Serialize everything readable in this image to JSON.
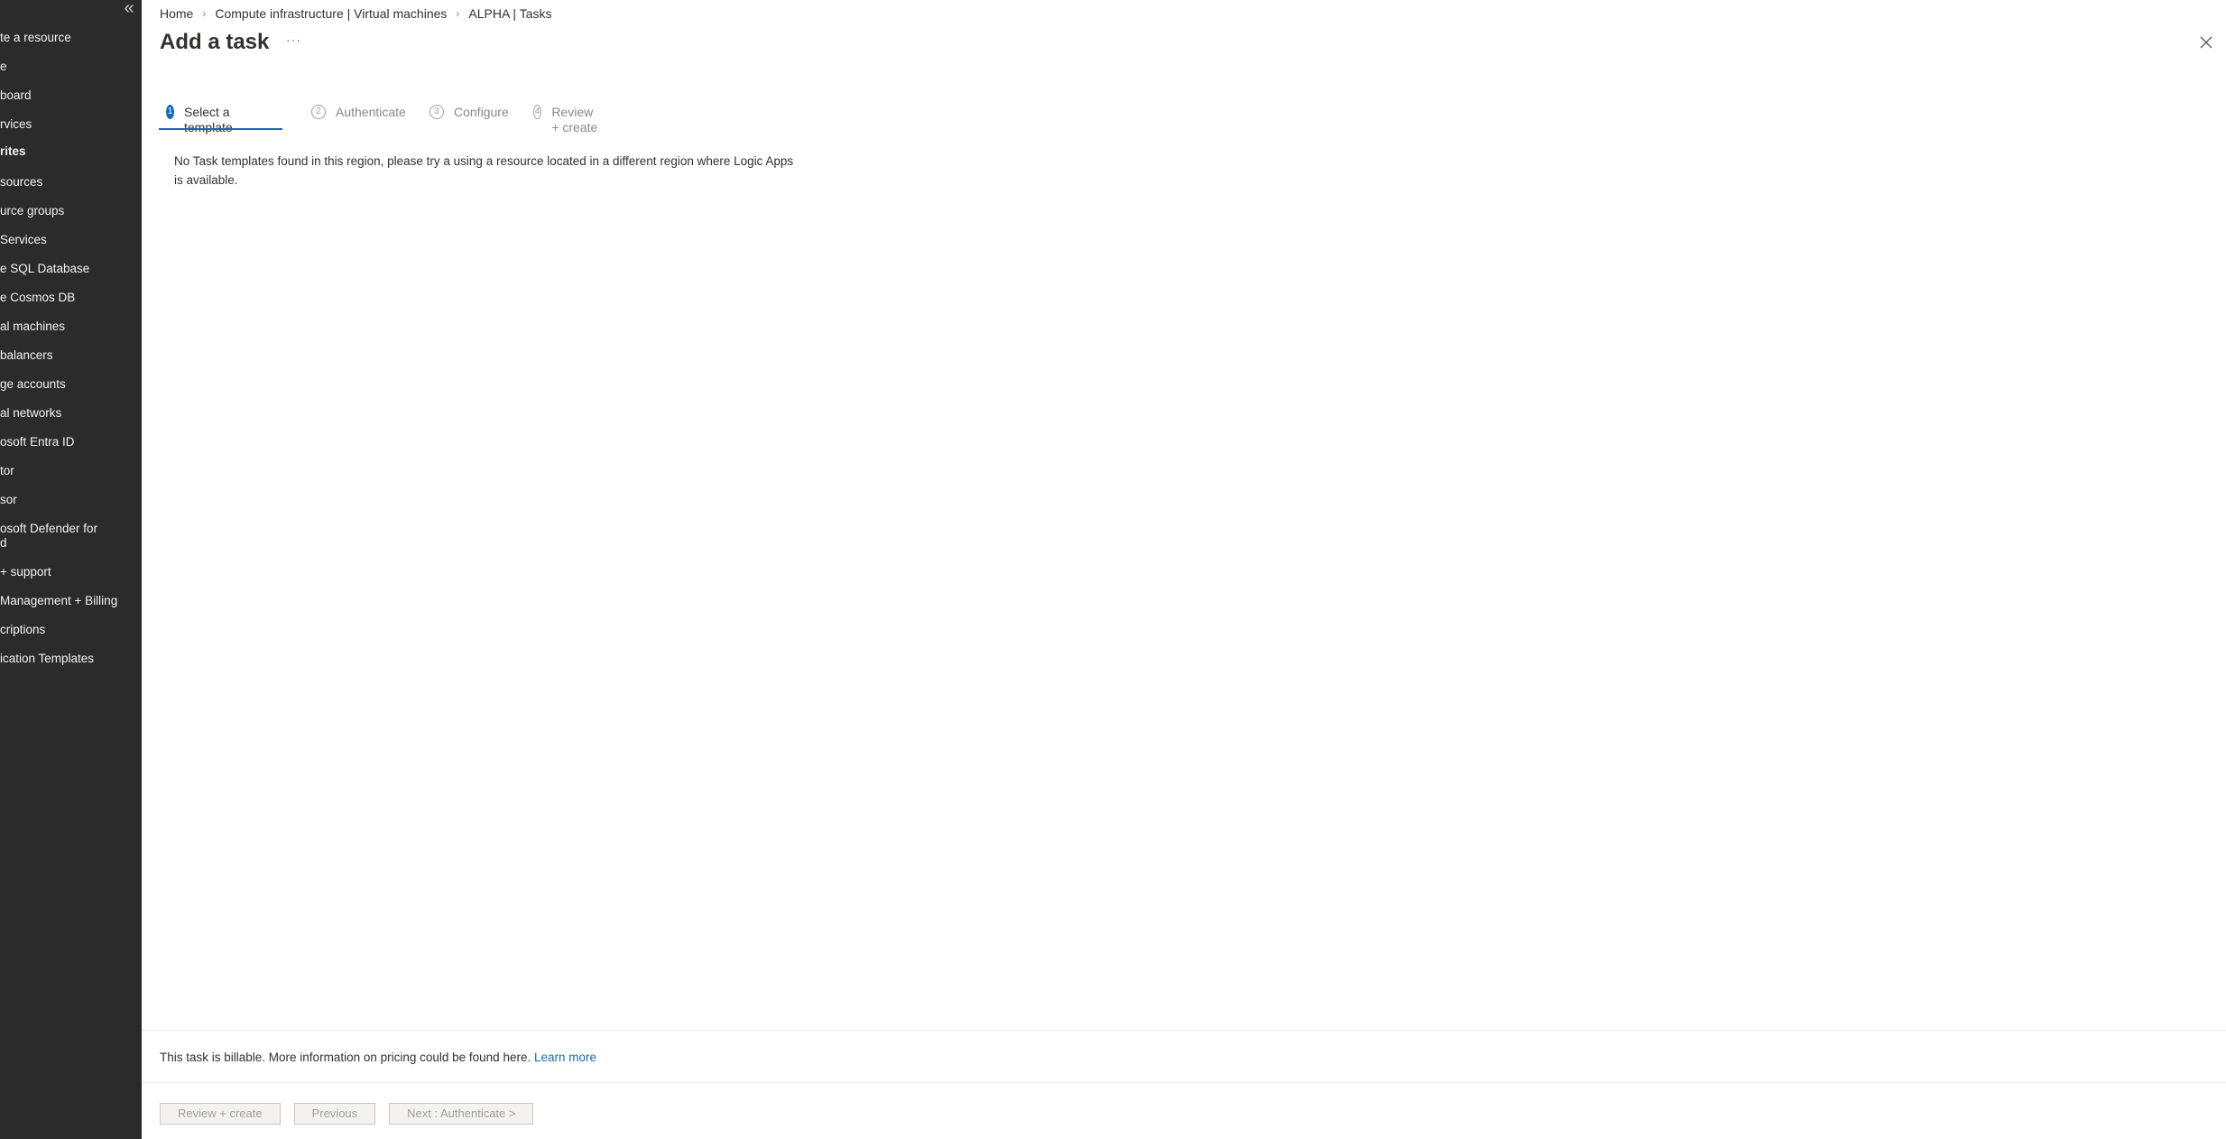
{
  "sidebar": {
    "collapse_label": "«",
    "items": [
      {
        "label": "te a resource",
        "section": false
      },
      {
        "label": "e",
        "section": false
      },
      {
        "label": "board",
        "section": false
      },
      {
        "label": "rvices",
        "section": false
      },
      {
        "label": "rites",
        "section": true
      },
      {
        "label": "sources",
        "section": false
      },
      {
        "label": "urce groups",
        "section": false
      },
      {
        "label": "Services",
        "section": false
      },
      {
        "label": "e SQL Database",
        "section": false
      },
      {
        "label": "e Cosmos DB",
        "section": false
      },
      {
        "label": "al machines",
        "section": false
      },
      {
        "label": " balancers",
        "section": false
      },
      {
        "label": "ge accounts",
        "section": false
      },
      {
        "label": "al networks",
        "section": false
      },
      {
        "label": "osoft Entra ID",
        "section": false
      },
      {
        "label": "tor",
        "section": false
      },
      {
        "label": "sor",
        "section": false
      },
      {
        "label": "osoft Defender for",
        "section": false
      },
      {
        "label": "d",
        "section": false
      },
      {
        "label": " + support",
        "section": false
      },
      {
        "label": " Management + Billing",
        "section": false
      },
      {
        "label": "criptions",
        "section": false
      },
      {
        "label": "ication Templates",
        "section": false
      }
    ]
  },
  "breadcrumb": {
    "items": [
      "Home",
      "Compute infrastructure | Virtual machines",
      "ALPHA | Tasks"
    ],
    "separator": "›"
  },
  "header": {
    "title": "Add a task",
    "more_label": "···"
  },
  "wizard": {
    "steps": [
      {
        "number": "1",
        "label": "Select a template",
        "active": true
      },
      {
        "number": "2",
        "label": "Authenticate",
        "active": false
      },
      {
        "number": "3",
        "label": "Configure",
        "active": false
      },
      {
        "number": "4",
        "label": "Review + create",
        "active": false
      }
    ]
  },
  "main": {
    "message": "No Task templates found in this region, please try a using a resource located in a different region where Logic Apps is available."
  },
  "footer": {
    "billing_text": "This task is billable. More information on pricing could be found here.",
    "learn_more": "Learn more",
    "buttons": {
      "review_create": "Review + create",
      "previous": "Previous",
      "next": "Next : Authenticate >"
    }
  },
  "colors": {
    "accent": "#0f6cbd",
    "sidebar_bg": "#2b2b2b"
  }
}
